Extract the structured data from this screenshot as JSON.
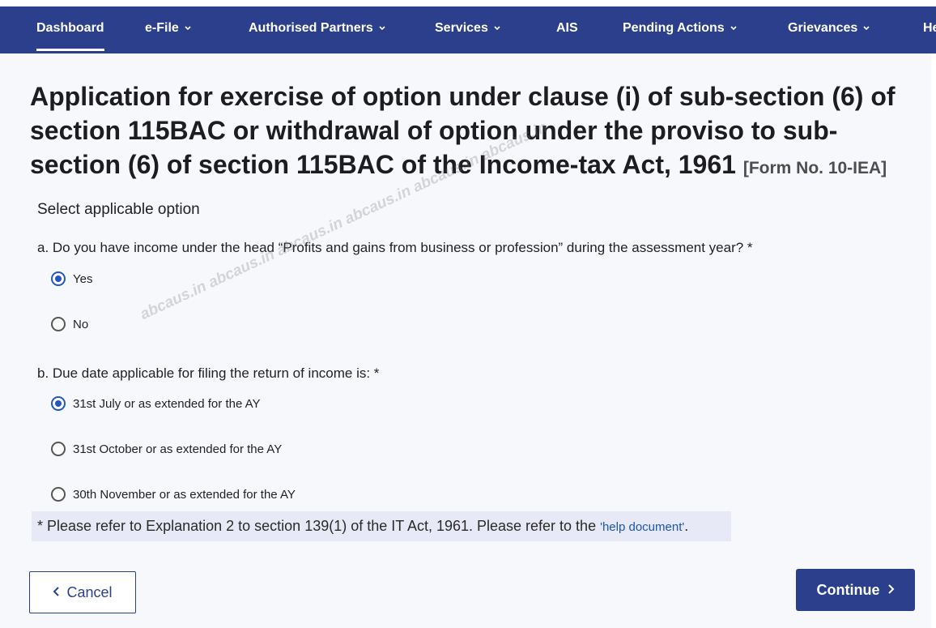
{
  "nav": {
    "items": [
      {
        "label": "Dashboard",
        "has_dropdown": false,
        "active": true
      },
      {
        "label": "e-File",
        "has_dropdown": true
      },
      {
        "label": "Authorised Partners",
        "has_dropdown": true
      },
      {
        "label": "Services",
        "has_dropdown": true
      },
      {
        "label": "AIS",
        "has_dropdown": false
      },
      {
        "label": "Pending Actions",
        "has_dropdown": true
      },
      {
        "label": "Grievances",
        "has_dropdown": true
      },
      {
        "label": "He",
        "has_dropdown": false
      }
    ]
  },
  "page": {
    "title": "Application for exercise of option under clause (i) of sub-section (6) of section 115BAC or withdrawal of option under the proviso to sub-section (6) of section 115BAC of the Income-tax Act, 1961",
    "form_no": "[Form No. 10-IEA]",
    "select_label": "Select applicable option"
  },
  "questions": [
    {
      "label": "a. Do you have income under the head “Profits and gains from business or profession” during the assessment year? *",
      "options": [
        {
          "label": "Yes",
          "checked": true
        },
        {
          "label": "No",
          "checked": false
        }
      ]
    },
    {
      "label": "b. Due date applicable for filing the return of income is: *",
      "options": [
        {
          "label": "31st July or as extended for the AY",
          "checked": true
        },
        {
          "label": "31st October or as extended for the AY",
          "checked": false
        },
        {
          "label": "30th November or as extended for the AY",
          "checked": false
        }
      ]
    }
  ],
  "note": {
    "text": "* Please refer to Explanation 2 to section 139(1) of the IT Act, 1961. Please refer to the ",
    "link": "'help document'",
    "suffix": "."
  },
  "buttons": {
    "cancel": "Cancel",
    "continue": "Continue"
  },
  "watermark": "abcaus.in   abcaus.in   abcaus.in   abcaus.in   abcaus.in   abcaus.in",
  "colors": {
    "nav_bg": "#2b3f8c",
    "radio_checked": "#2458b8",
    "note_bg": "#e8e9f6",
    "link": "#1a56b6"
  }
}
